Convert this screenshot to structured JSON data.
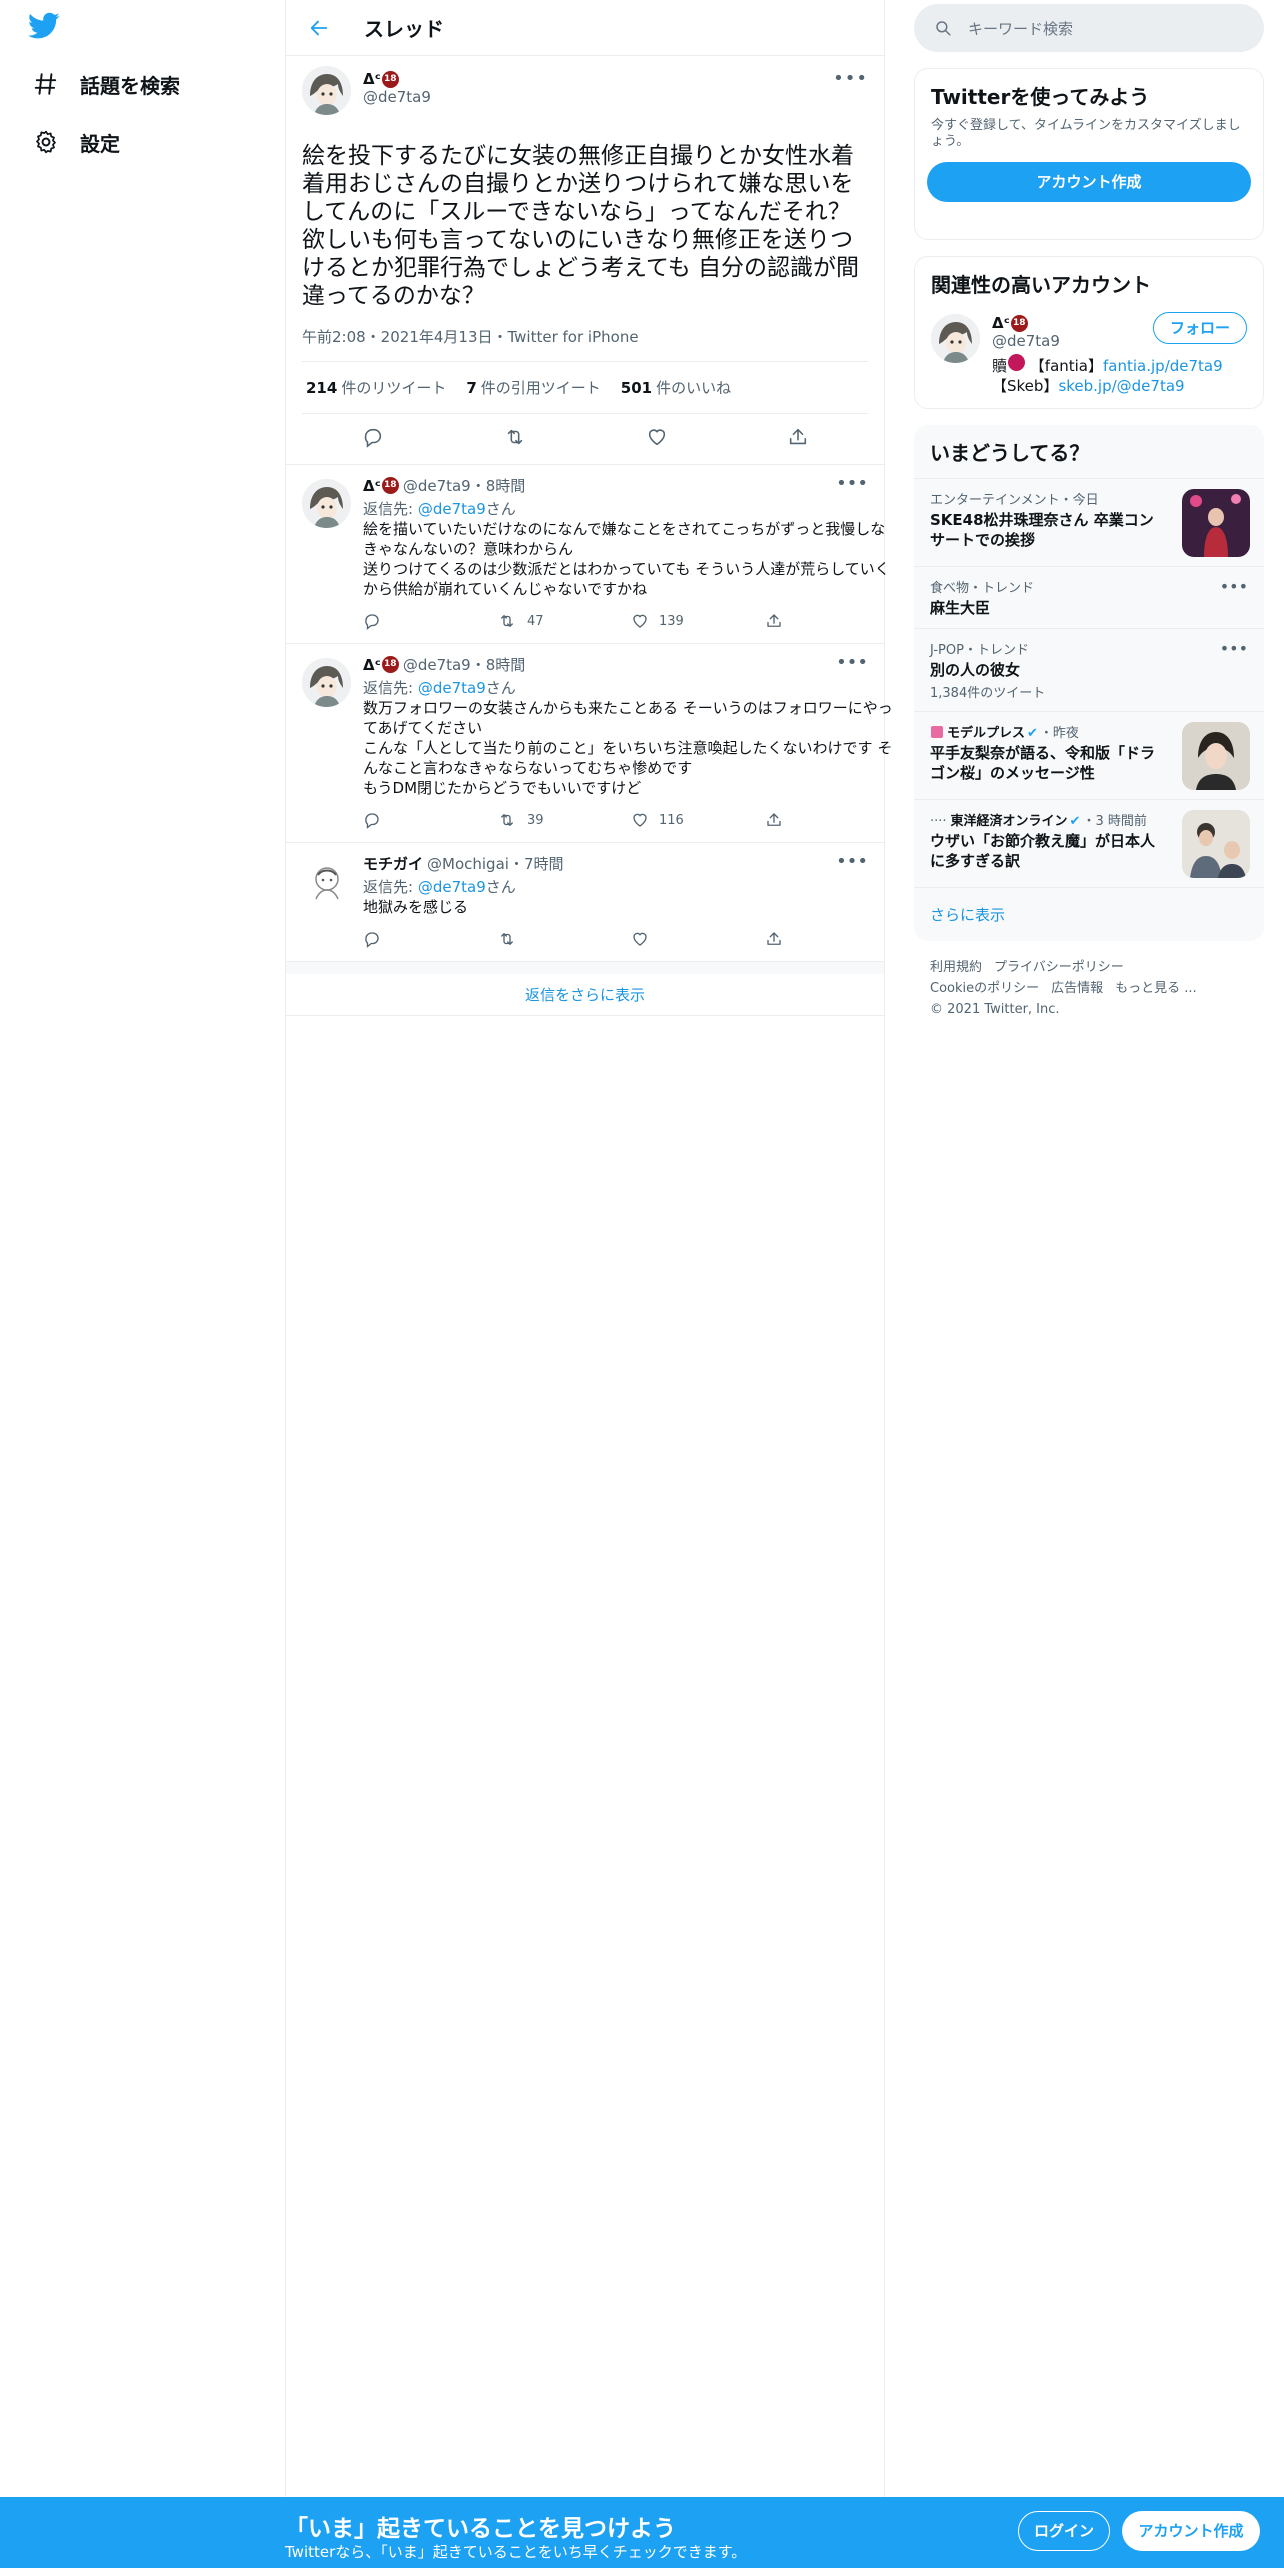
{
  "nav": {
    "logo": "twitter-bird-icon",
    "items": [
      {
        "label": "話題を検索",
        "icon": "hashtag-icon"
      },
      {
        "label": "設定",
        "icon": "gear-icon"
      }
    ]
  },
  "header": {
    "title": "スレッド"
  },
  "main_tweet": {
    "display_name": "Δᶜ",
    "badge": "18",
    "handle": "@de7ta9",
    "text": "絵を投下するたびに女装の無修正自撮りとか女性水着着用おじさんの自撮りとか送りつけられて嫌な思いをしてんのに「スルーできないなら」ってなんだそれ？\n欲しいも何も言ってないのにいきなり無修正を送りつけるとか犯罪行為でしょどう考えても 自分の認識が間違ってるのかな？",
    "meta": "午前2:08・2021年4月13日・Twitter for iPhone",
    "retweets": "214",
    "retweets_label": "件のリツイート",
    "quotes": "7",
    "quotes_label": "件の引用ツイート",
    "likes": "501",
    "likes_label": "件のいいね"
  },
  "replies": [
    {
      "display_name": "Δᶜ",
      "badge": "18",
      "handle": "@de7ta9",
      "time": "・8時間",
      "reply_prefix": "返信先: ",
      "reply_to": "@de7ta9",
      "reply_suffix": "さん",
      "text": "絵を描いていたいだけなのになんで嫌なことをされてこっちがずっと我慢しなきゃなんないの？意味わからん\n送りつけてくるのは少数派だとはわかっていても そういう人達が荒らしていくから供給が崩れていくんじゃないですかね",
      "retweets": "47",
      "likes": "139"
    },
    {
      "display_name": "Δᶜ",
      "badge": "18",
      "handle": "@de7ta9",
      "time": "・8時間",
      "reply_prefix": "返信先: ",
      "reply_to": "@de7ta9",
      "reply_suffix": "さん",
      "text": "数万フォロワーの女装さんからも来たことある そーいうのはフォロワーにやってあげてください\nこんな「人として当たり前のこと」をいちいち注意喚起したくないわけです そんなこと言わなきゃならないってむちゃ惨めです\nもうDM閉じたからどうでもいいですけど",
      "retweets": "39",
      "likes": "116"
    },
    {
      "display_name": "モチガイ",
      "handle": "@Mochigai",
      "time": "・7時間",
      "reply_prefix": "返信先: ",
      "reply_to": "@de7ta9",
      "reply_suffix": "さん",
      "text": "地獄みを感じる"
    }
  ],
  "show_more_replies": "返信をさらに表示",
  "search": {
    "placeholder": "キーワード検索"
  },
  "join": {
    "title": "Twitterを使ってみよう",
    "subtitle": "今すぐ登録して、タイムラインをカスタマイズしましょう。",
    "button": "アカウント作成"
  },
  "related": {
    "title": "関連性の高いアカウント",
    "display_name": "Δᶜ",
    "badge": "18",
    "handle": "@de7ta9",
    "follow": "フォロー",
    "bio_line1_prefix": "贖",
    "bio_line1_mid": " 【fantia】",
    "bio_line1_link": "fantia.jp/de7ta9",
    "bio_line2_prefix": "【Skeb】",
    "bio_line2_link": "skeb.jp/@de7ta9"
  },
  "trends": {
    "title": "いまどうしてる？",
    "items": [
      {
        "meta": "エンターテインメント・今日",
        "title": "SKE48松井珠理奈さん 卒業コンサートでの挨拶"
      },
      {
        "meta": "食べ物・トレンド",
        "title": "麻生大臣"
      },
      {
        "meta": "J-POP・トレンド",
        "title": "別の人の彼女",
        "count": "1,384件のツイート"
      },
      {
        "meta_source": "モデルプレス",
        "meta_time": "・昨夜",
        "title": "平手友梨奈が語る、令和版「ドラゴン桜」のメッセージ性"
      },
      {
        "meta_source": "東洋経済オンライン",
        "meta_time": "・3 時間前",
        "title": "ウザい「お節介教え魔」が日本人に多すぎる訳"
      }
    ],
    "show_more": "さらに表示"
  },
  "footer": {
    "links": [
      "利用規約",
      "プライバシーポリシー",
      "Cookieのポリシー",
      "広告情報",
      "もっと見る ..."
    ],
    "copyright": "© 2021 Twitter, Inc."
  },
  "bottom_bar": {
    "title": "「いま」起きていることを見つけよう",
    "subtitle": "Twitterなら、「いま」起きていることをいち早くチェックできます。",
    "login": "ログイン",
    "signup": "アカウント作成"
  },
  "colors": {
    "accent": "#1da1f2",
    "link": "#1b95e0",
    "badge": "#9b1a1a"
  }
}
